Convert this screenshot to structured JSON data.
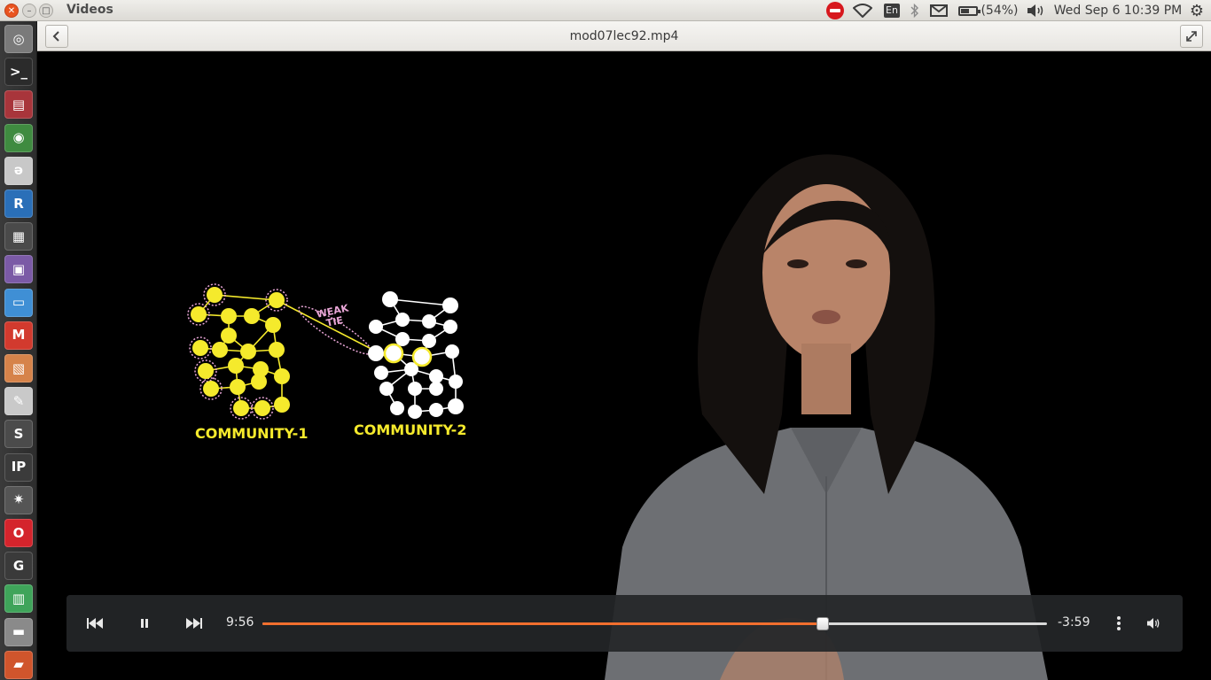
{
  "window": {
    "app_title": "Videos",
    "close_glyph": "✕",
    "minimize_glyph": "–",
    "maximize_glyph": "□"
  },
  "tray": {
    "language": "En",
    "battery": "(54%)",
    "clock": "Wed Sep  6 10:39 PM",
    "icons": [
      "do-not-disturb-icon",
      "wifi-icon",
      "keyboard-language-icon",
      "bluetooth-icon",
      "mail-icon",
      "battery-icon",
      "volume-icon",
      "system-gear-icon"
    ]
  },
  "launcher": {
    "items": [
      {
        "name": "dash-home",
        "glyph": "◎",
        "color": "#7a7a7a"
      },
      {
        "name": "terminal",
        "glyph": ">_",
        "color": "#2b2b2b"
      },
      {
        "name": "file-cabinet",
        "glyph": "▤",
        "color": "#a8353b"
      },
      {
        "name": "chrome",
        "glyph": "◉",
        "color": "#3f8b40"
      },
      {
        "name": "pdf-reader",
        "glyph": "ǝ",
        "color": "#c8c8c8"
      },
      {
        "name": "r-language",
        "glyph": "R",
        "color": "#2a6fb8"
      },
      {
        "name": "video-clapper",
        "glyph": "▦",
        "color": "#4a4a4a"
      },
      {
        "name": "screen-recorder",
        "glyph": "▣",
        "color": "#7b5aa6"
      },
      {
        "name": "document",
        "glyph": "▭",
        "color": "#3f8fd5"
      },
      {
        "name": "gmail",
        "glyph": "M",
        "color": "#d23a2e"
      },
      {
        "name": "presentation",
        "glyph": "▧",
        "color": "#d6834a"
      },
      {
        "name": "text-editor",
        "glyph": "✎",
        "color": "#c9c9c9"
      },
      {
        "name": "sublime",
        "glyph": "S",
        "color": "#4b4b4b"
      },
      {
        "name": "ipython",
        "glyph": "IP",
        "color": "#3b3b3b"
      },
      {
        "name": "network-app",
        "glyph": "✷",
        "color": "#555555"
      },
      {
        "name": "opera",
        "glyph": "O",
        "color": "#d4242c"
      },
      {
        "name": "gephi",
        "glyph": "G",
        "color": "#3a3a3a"
      },
      {
        "name": "spreadsheet",
        "glyph": "▥",
        "color": "#3fa45a"
      },
      {
        "name": "drive",
        "glyph": "▬",
        "color": "#8a8a8a"
      },
      {
        "name": "software-center",
        "glyph": "▰",
        "color": "#d0552c"
      },
      {
        "name": "workspace",
        "glyph": "▱",
        "color": "#9c4bb0"
      }
    ]
  },
  "header": {
    "video_title": "mod07lec92.mp4",
    "back_glyph": "‹",
    "fullscreen_glyph": "⤢"
  },
  "video": {
    "community_1_label": "COMMUNITY-1",
    "community_2_label": "COMMUNITY-2",
    "weak_tie_line1": "WEAK",
    "weak_tie_line2": "TIE",
    "community_1_color": "#f5ea2c",
    "community_2_color": "#ffffff",
    "weak_tie_color": "#e9a6d7"
  },
  "controls": {
    "elapsed": "9:56",
    "remaining": "-3:59",
    "progress_fraction": 0.7136,
    "accent_color": "#f26f2e"
  }
}
